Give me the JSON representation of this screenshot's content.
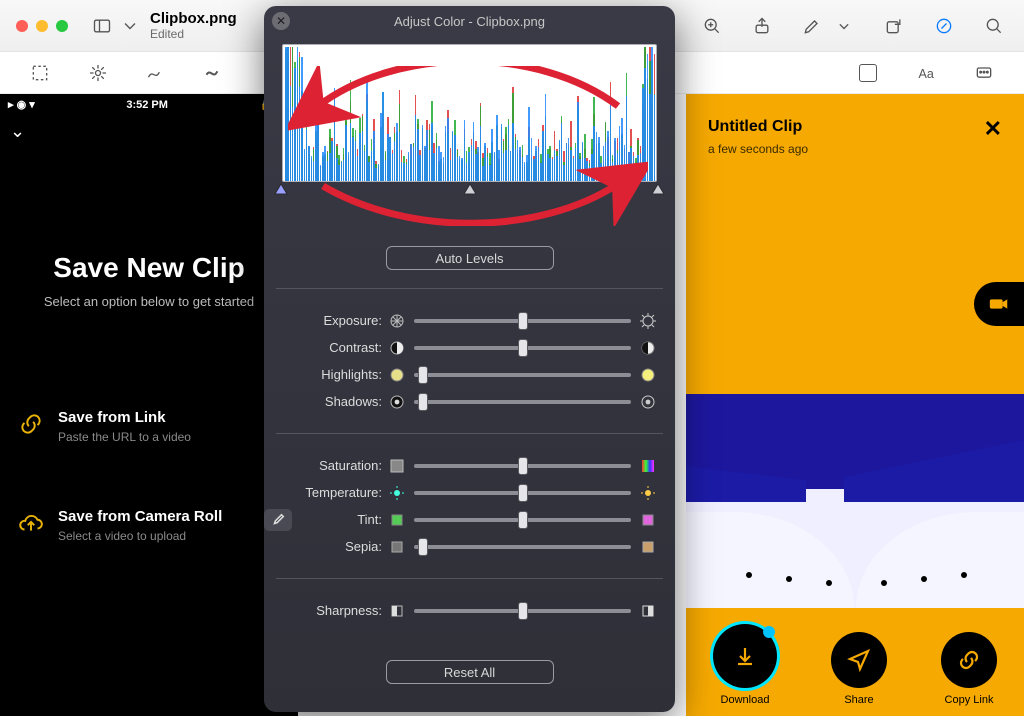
{
  "preview": {
    "filename": "Clipbox.png",
    "subtitle": "Edited",
    "toolbar": {
      "zoom_label": "Zoom"
    }
  },
  "adjust_panel": {
    "title": "Adjust Color - Clipbox.png",
    "auto_levels": "Auto Levels",
    "reset_all": "Reset All",
    "sliders": [
      {
        "label": "Exposure:",
        "value": 50
      },
      {
        "label": "Contrast:",
        "value": 50
      },
      {
        "label": "Highlights:",
        "value": 4
      },
      {
        "label": "Shadows:",
        "value": 4
      }
    ],
    "sliders2": [
      {
        "label": "Saturation:",
        "value": 50
      },
      {
        "label": "Temperature:",
        "value": 50
      },
      {
        "label": "Tint:",
        "value": 50
      },
      {
        "label": "Sepia:",
        "value": 4
      }
    ],
    "sliders3": [
      {
        "label": "Sharpness:",
        "value": 50
      }
    ]
  },
  "phone_left": {
    "time": "3:52 PM",
    "title": "Save New Clip",
    "subtitle": "Select an option below to get started",
    "options": [
      {
        "title": "Save from Link",
        "subtitle": "Paste the URL to a video"
      },
      {
        "title": "Save from Camera Roll",
        "subtitle": "Select a video to upload"
      }
    ]
  },
  "phone_right": {
    "title": "Untitled Clip",
    "subtitle": "a few seconds ago",
    "actions": [
      {
        "label": "Download"
      },
      {
        "label": "Share"
      },
      {
        "label": "Copy Link"
      }
    ]
  }
}
